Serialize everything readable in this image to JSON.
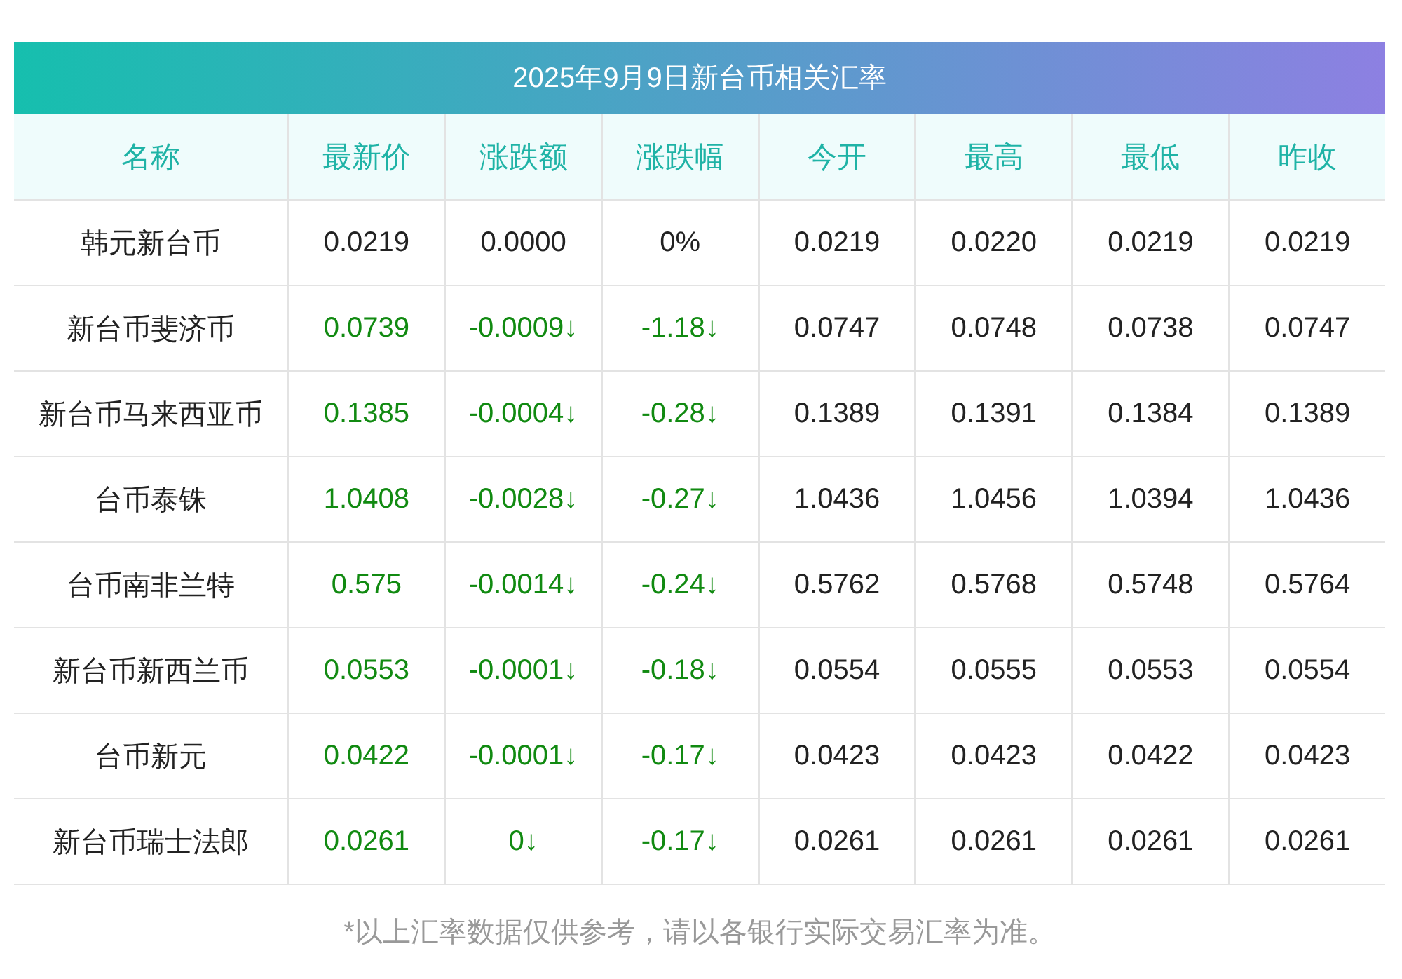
{
  "title": "2025年9月9日新台币相关汇率",
  "columns": [
    "名称",
    "最新价",
    "涨跌额",
    "涨跌幅",
    "今开",
    "最高",
    "最低",
    "昨收"
  ],
  "rows": [
    {
      "color": "#222222",
      "name": "韩元新台币",
      "latest": "0.0219",
      "change": "0.0000",
      "change_pct": "0%",
      "open": "0.0219",
      "high": "0.0220",
      "low": "0.0219",
      "prev_close": "0.0219"
    },
    {
      "color": "#118a11",
      "name": "新台币斐济币",
      "latest": "0.0739",
      "change": "-0.0009↓",
      "change_pct": "-1.18↓",
      "open": "0.0747",
      "high": "0.0748",
      "low": "0.0738",
      "prev_close": "0.0747"
    },
    {
      "color": "#118a11",
      "name": "新台币马来西亚币",
      "latest": "0.1385",
      "change": "-0.0004↓",
      "change_pct": "-0.28↓",
      "open": "0.1389",
      "high": "0.1391",
      "low": "0.1384",
      "prev_close": "0.1389"
    },
    {
      "color": "#118a11",
      "name": "台币泰铢",
      "latest": "1.0408",
      "change": "-0.0028↓",
      "change_pct": "-0.27↓",
      "open": "1.0436",
      "high": "1.0456",
      "low": "1.0394",
      "prev_close": "1.0436"
    },
    {
      "color": "#118a11",
      "name": "台币南非兰特",
      "latest": "0.575",
      "change": "-0.0014↓",
      "change_pct": "-0.24↓",
      "open": "0.5762",
      "high": "0.5768",
      "low": "0.5748",
      "prev_close": "0.5764"
    },
    {
      "color": "#118a11",
      "name": "新台币新西兰币",
      "latest": "0.0553",
      "change": "-0.0001↓",
      "change_pct": "-0.18↓",
      "open": "0.0554",
      "high": "0.0555",
      "low": "0.0553",
      "prev_close": "0.0554"
    },
    {
      "color": "#118a11",
      "name": "台币新元",
      "latest": "0.0422",
      "change": "-0.0001↓",
      "change_pct": "-0.17↓",
      "open": "0.0423",
      "high": "0.0423",
      "low": "0.0422",
      "prev_close": "0.0423"
    },
    {
      "color": "#118a11",
      "name": "新台币瑞士法郎",
      "latest": "0.0261",
      "change": "0↓",
      "change_pct": "-0.17↓",
      "open": "0.0261",
      "high": "0.0261",
      "low": "0.0261",
      "prev_close": "0.0261"
    }
  ],
  "footnote": "*以上汇率数据仅供参考，请以各银行实际交易汇率为准。"
}
